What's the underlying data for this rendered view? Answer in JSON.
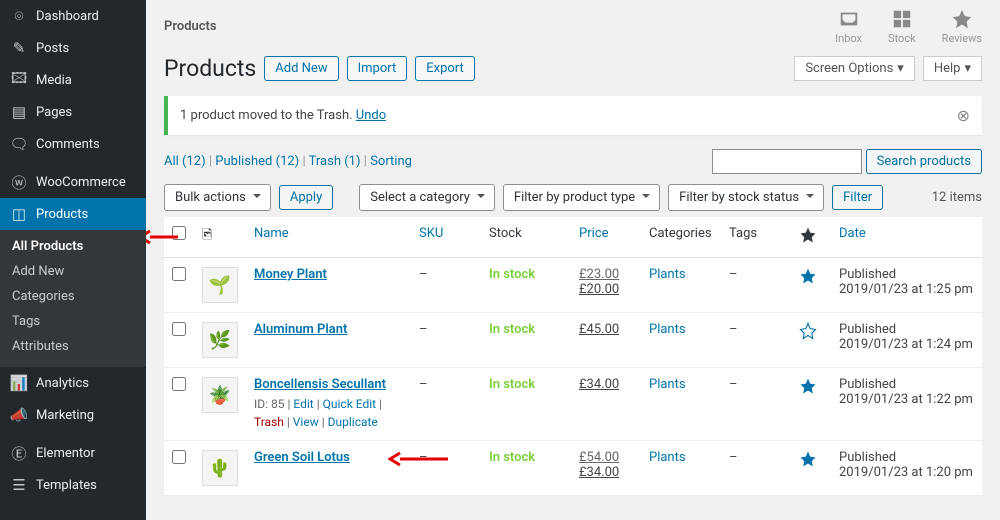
{
  "sidebar": {
    "items": [
      {
        "label": "Dashboard",
        "icon": "gauge"
      },
      {
        "label": "Posts",
        "icon": "pin"
      },
      {
        "label": "Media",
        "icon": "media"
      },
      {
        "label": "Pages",
        "icon": "page"
      },
      {
        "label": "Comments",
        "icon": "comment"
      },
      {
        "label": "WooCommerce",
        "icon": "woo"
      },
      {
        "label": "Products",
        "icon": "box",
        "current": true
      },
      {
        "label": "Analytics",
        "icon": "chart"
      },
      {
        "label": "Marketing",
        "icon": "megaphone"
      },
      {
        "label": "Elementor",
        "icon": "elementor"
      },
      {
        "label": "Templates",
        "icon": "templates"
      }
    ],
    "submenu": [
      {
        "label": "All Products",
        "active": true
      },
      {
        "label": "Add New"
      },
      {
        "label": "Categories"
      },
      {
        "label": "Tags"
      },
      {
        "label": "Attributes"
      }
    ]
  },
  "topbar": {
    "crumb": "Products",
    "icons": [
      {
        "label": "Inbox"
      },
      {
        "label": "Stock"
      },
      {
        "label": "Reviews"
      }
    ]
  },
  "header": {
    "title": "Products",
    "buttons": [
      "Add New",
      "Import",
      "Export"
    ],
    "screen_options": "Screen Options",
    "help": "Help"
  },
  "notice": {
    "text": "1 product moved to the Trash. ",
    "undo": "Undo"
  },
  "views": {
    "all_label": "All",
    "all_count": "(12)",
    "pub_label": "Published",
    "pub_count": "(12)",
    "trash_label": "Trash",
    "trash_count": "(1)",
    "sort_label": "Sorting"
  },
  "search": {
    "placeholder": "",
    "button": "Search products"
  },
  "bulk": {
    "bulk_label": "Bulk actions",
    "apply": "Apply",
    "cat_label": "Select a category",
    "type_label": "Filter by product type",
    "stock_label": "Filter by stock status",
    "filter": "Filter",
    "count": "12 items"
  },
  "columns": {
    "name": "Name",
    "sku": "SKU",
    "stock": "Stock",
    "price": "Price",
    "categories": "Categories",
    "tags": "Tags",
    "date": "Date"
  },
  "rows": [
    {
      "name": "Money Plant",
      "sku": "–",
      "stock": "In stock",
      "price_old": "£23.00",
      "price_new": "£20.00",
      "category": "Plants",
      "tags": "–",
      "featured": true,
      "date": "Published\n2019/01/23 at 1:25 pm",
      "thumb": "🌱"
    },
    {
      "name": "Aluminum Plant",
      "sku": "–",
      "stock": "In stock",
      "price_new": "£45.00",
      "category": "Plants",
      "tags": "–",
      "featured": false,
      "date": "Published\n2019/01/23 at 1:24 pm",
      "thumb": "🌿"
    },
    {
      "name": "Boncellensis Secullant",
      "sku": "–",
      "stock": "In stock",
      "price_new": "£34.00",
      "category": "Plants",
      "tags": "–",
      "featured": true,
      "date": "Published\n2019/01/23 at 1:22 pm",
      "thumb": "🪴",
      "actions": {
        "id": "ID: 85",
        "edit": "Edit",
        "quick": "Quick Edit",
        "trash": "Trash",
        "view": "View",
        "dup": "Duplicate"
      }
    },
    {
      "name": "Green Soil Lotus",
      "sku": "–",
      "stock": "In stock",
      "price_old": "£54.00",
      "price_new": "£34.00",
      "category": "Plants",
      "tags": "–",
      "featured": true,
      "date": "Published\n2019/01/23 at 1:20 pm",
      "thumb": "🌵"
    }
  ]
}
